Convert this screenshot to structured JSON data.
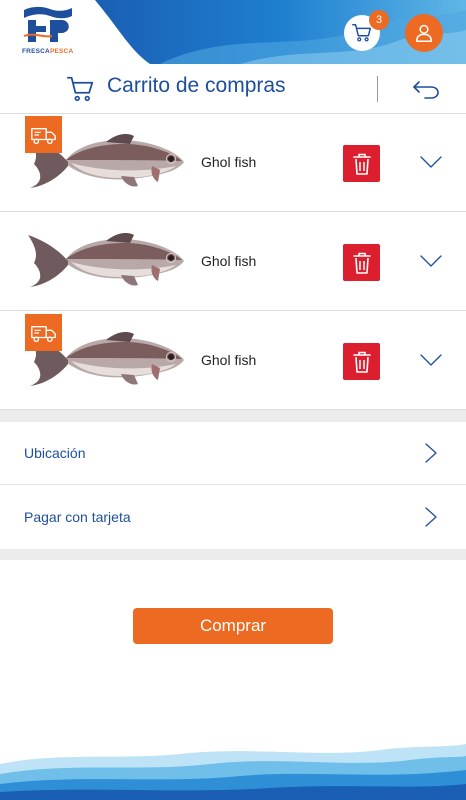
{
  "brand": {
    "logo_letters": "FP",
    "name_part1": "FRESCA",
    "name_part2": "PESCA"
  },
  "header": {
    "cart_count": "3",
    "cart_icon": "shopping-cart-icon",
    "user_icon": "user-icon"
  },
  "titlebar": {
    "title": "Carrito de compras",
    "back_icon": "undo-arrow-icon"
  },
  "cart": {
    "items": [
      {
        "name": "Ghol fish",
        "delivery_badge": true
      },
      {
        "name": "Ghol fish",
        "delivery_badge": false
      },
      {
        "name": "Ghol fish",
        "delivery_badge": true
      }
    ]
  },
  "options": {
    "location_label": "Ubicación",
    "payment_label": "Pagar con tarjeta"
  },
  "actions": {
    "buy_label": "Comprar"
  },
  "colors": {
    "brand_blue": "#1d4f9c",
    "accent_orange": "#ec6a22",
    "delete_red": "#dc1f2e"
  }
}
